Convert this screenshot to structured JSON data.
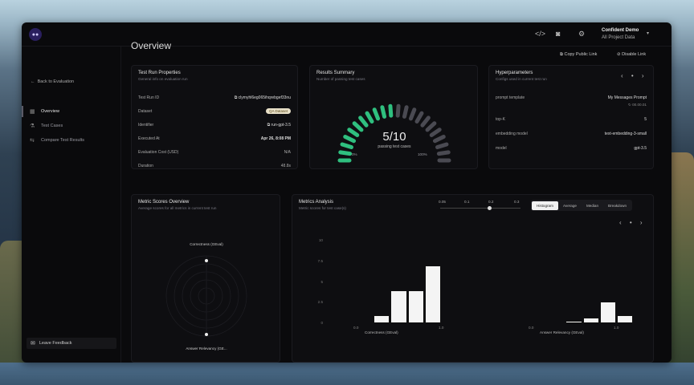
{
  "header": {
    "logo_text": "●●",
    "user_name": "Confident Demo",
    "project": "All Project Data",
    "icons": [
      "code-icon",
      "discord-icon",
      "settings-icon",
      "chevron-down-icon"
    ]
  },
  "sidebar": {
    "back_label": "Back to Evaluation",
    "items": [
      {
        "label": "Overview",
        "icon": "grid-icon",
        "active": true
      },
      {
        "label": "Test Cases",
        "icon": "flask-icon",
        "active": false
      },
      {
        "label": "Compare Test Results",
        "icon": "compare-icon",
        "active": false
      }
    ],
    "feedback_label": "Leave Feedback"
  },
  "page": {
    "title": "Overview",
    "copy_link": "Copy Public Link",
    "disable_link": "Disable Link"
  },
  "test_run": {
    "title": "Test Run Properties",
    "subtitle": "General info on evaluation run",
    "rows": [
      {
        "label": "Test Run ID",
        "value": "clymyhl6eg065ihqrebgef33nu"
      },
      {
        "label": "Dataset",
        "value": "QA Dataset"
      },
      {
        "label": "Identifier",
        "value": "run-gpt-3.5"
      },
      {
        "label": "Executed At",
        "value": "Apr 26, 8:08 PM"
      },
      {
        "label": "Evaluation Cost (USD)",
        "value": "N/A"
      },
      {
        "label": "Duration",
        "value": "48.8s"
      }
    ]
  },
  "results": {
    "title": "Results Summary",
    "subtitle": "Number of passing test cases",
    "score": "5/10",
    "score_label": "passing test cases",
    "min_label": "0%",
    "max_label": "100%",
    "passing_fraction": 0.5,
    "colors": {
      "pass": "#2fbf7f",
      "fail": "#4a4a52"
    }
  },
  "hyper": {
    "title": "Hyperparameters",
    "subtitle": "Configs used in current test run",
    "pager": "‹ • ›",
    "rows": [
      {
        "label": "prompt template",
        "value": "My Messages Prompt",
        "sub": "00.00.01"
      },
      {
        "label": "top-K",
        "value": "5"
      },
      {
        "label": "embedding model",
        "value": "text-embedding-3-small"
      },
      {
        "label": "model",
        "value": "gpt-3.5"
      }
    ]
  },
  "metric_scores": {
    "title": "Metric Scores Overview",
    "subtitle": "Average scores for all metrics in current test run",
    "top_label": "Correctness (GEval)",
    "bottom_label": "Answer Relevancy (GE..."
  },
  "analysis": {
    "title": "Metrics Analysis",
    "subtitle": "Metric scores for test case(s)",
    "slider_ticks": [
      "0.05",
      "0.1",
      "0.2",
      "0.3"
    ],
    "tabs": [
      "Histogram",
      "Average",
      "Median",
      "Breakdown"
    ],
    "active_tab": "Histogram",
    "pager": "‹ • ›"
  },
  "chart_data": {
    "type": "bar",
    "yticks": [
      "10",
      "7.5",
      "5",
      "2.5",
      "0"
    ],
    "ylim": [
      0,
      10
    ],
    "series": [
      {
        "name": "Correctness (GEval)",
        "xrange": [
          "0.0",
          "1.0"
        ],
        "values": [
          0,
          1,
          4,
          4,
          7
        ]
      },
      {
        "name": "Answer Relevancy (GEval)",
        "xrange": [
          "0.0",
          "1.0"
        ],
        "values": [
          0,
          0,
          0.3,
          0.7,
          2.6,
          1
        ]
      }
    ]
  }
}
